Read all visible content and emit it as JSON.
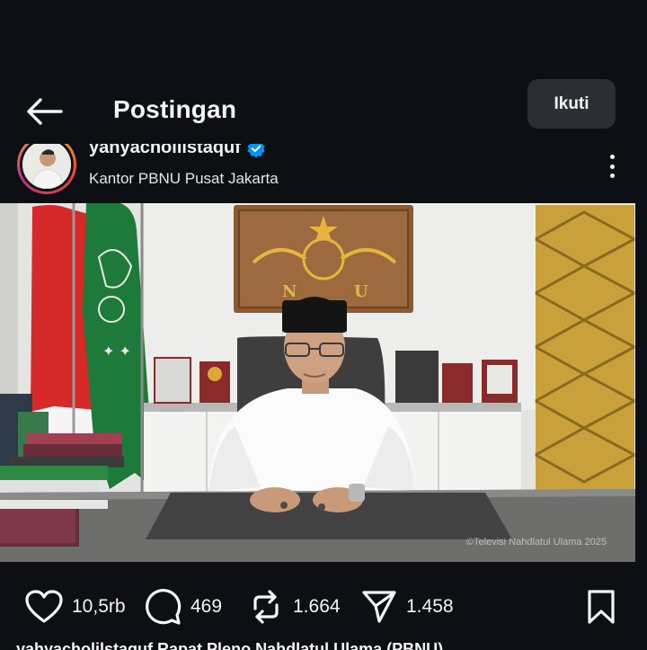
{
  "header": {
    "title": "Postingan",
    "follow_label": "Ikuti"
  },
  "post": {
    "username": "yahyacholilstaquf",
    "verified": true,
    "location": "Kantor PBNU Pusat Jakarta",
    "media": {
      "watermark": "©Televisi Nahdlatul Ulama 2025",
      "nu_emblem_letters": [
        "N",
        "U"
      ]
    },
    "counts": {
      "likes": "10,5rb",
      "comments": "469",
      "reposts": "1.664",
      "shares": "1.458"
    },
    "caption_preview": "yahyacholilstaquf Rapat Pleno Nahdlatul Ulama (PBNU) ..."
  },
  "colors": {
    "background": "#0c1014",
    "follow_button": "#2b2f35",
    "verified_badge": "#0095f6",
    "text": "#f5f5f5"
  },
  "icons": {
    "back": "arrow-left-icon",
    "more": "three-dots-icon",
    "like": "heart-icon",
    "comment": "comment-icon",
    "repost": "repost-icon",
    "share": "send-icon",
    "save": "bookmark-icon",
    "verified": "verified-badge-icon"
  }
}
